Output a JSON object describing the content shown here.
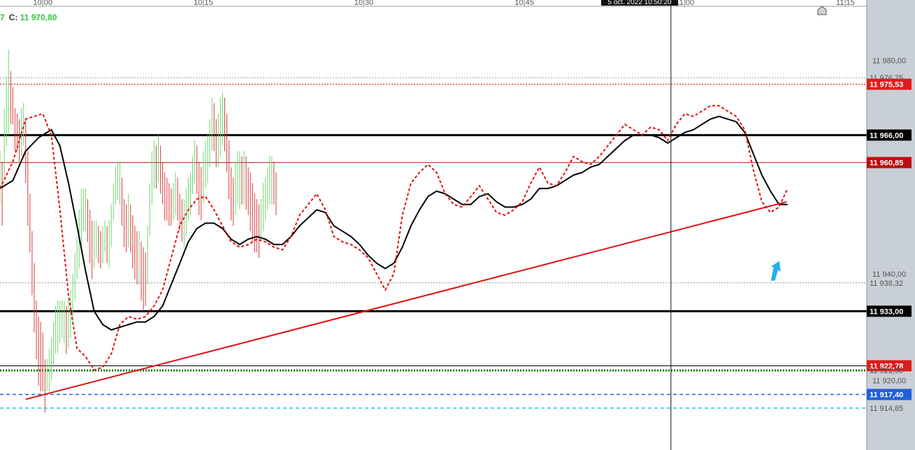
{
  "header": {
    "open_fragment": "7",
    "close_label": "C:",
    "close_value": "11 970,80",
    "cursor_date": "5 oct. 2022 10:50:20"
  },
  "colors": {
    "up_bar": "#6fd66f",
    "down_bar": "#d33a3a",
    "fast_ma": "#e01010",
    "slow_ma": "#000000",
    "trendline": "#e01010",
    "blue_dashed": "#1f5fd8",
    "cyan_dashed": "#21c0e6",
    "green_dotted": "#0a7a0a",
    "arrow": "#22b0ee"
  },
  "chart_data": {
    "type": "line",
    "title": "",
    "x_ticks": [
      {
        "t": 0,
        "label": "10:00"
      },
      {
        "t": 15,
        "label": "10:15"
      },
      {
        "t": 30,
        "label": "10:30"
      },
      {
        "t": 45,
        "label": "10:45"
      },
      {
        "t": 60,
        "label": "11:00"
      },
      {
        "t": 75,
        "label": "11:15"
      }
    ],
    "y_ticks": [
      {
        "v": 11980.0,
        "label": "11 980,00"
      },
      {
        "v": 11940.0,
        "label": "11 940,00"
      },
      {
        "v": 11920.0,
        "label": "11 920,00"
      }
    ],
    "xlim": [
      -4,
      77
    ],
    "ylim": [
      11907,
      11990
    ],
    "levels": [
      {
        "name": "level-11976",
        "v": 11976.75,
        "label": "11 976,75",
        "style": "grey-dotted",
        "tag": false
      },
      {
        "name": "level-11975",
        "v": 11975.53,
        "label": "11 975,53",
        "style": "red-dotted",
        "tag": "red"
      },
      {
        "name": "level-11966",
        "v": 11966.0,
        "label": "11 966,00",
        "style": "black-thick",
        "tag": "black"
      },
      {
        "name": "level-11960",
        "v": 11960.85,
        "label": "11 960,85",
        "style": "red-thin",
        "tag": "darkred"
      },
      {
        "name": "level-11938",
        "v": 11938.32,
        "label": "11 938,32",
        "style": "grey-dotted",
        "tag": false
      },
      {
        "name": "level-11933",
        "v": 11933.0,
        "label": "11 933,00",
        "style": "black-thick",
        "tag": "black"
      },
      {
        "name": "level-11922",
        "v": 11922.78,
        "label": "11 922,78",
        "style": "black-thin",
        "tag": "red"
      },
      {
        "name": "level-11921",
        "v": 11921.9,
        "label": "11 921,90",
        "style": "green-dotted",
        "tag": false
      },
      {
        "name": "level-11917",
        "v": 11917.4,
        "label": "11 917,40",
        "style": "blue-dashed",
        "tag": "blue"
      },
      {
        "name": "level-11914",
        "v": 11914.85,
        "label": "11 914,85",
        "style": "cyan-dashed",
        "tag": false
      }
    ],
    "trendline": {
      "t1": -1.6,
      "v1": 11916.5,
      "t2": 69.5,
      "v2": 11953.5
    },
    "cursor_t": 58.7,
    "arrow": {
      "t": 68.3,
      "v": 11942.0
    },
    "bars_t_start": -4,
    "bars_step": 0.2,
    "bars": [
      [
        11963.0,
        11953.0
      ],
      [
        11961.0,
        11949.0
      ],
      [
        11971.0,
        11958.0
      ],
      [
        11977.0,
        11964.0
      ],
      [
        11982.0,
        11966.0
      ],
      [
        11978.0,
        11968.0
      ],
      [
        11975.0,
        11968.0
      ],
      [
        11971.0,
        11963.0
      ],
      [
        11970.0,
        11963.0
      ],
      [
        11969.0,
        11961.0
      ],
      [
        11971.0,
        11962.0
      ],
      [
        11972.0,
        11964.0
      ],
      [
        11969.0,
        11957.0
      ],
      [
        11963.0,
        11949.0
      ],
      [
        11955.0,
        11944.0
      ],
      [
        11948.0,
        11936.0
      ],
      [
        11942.0,
        11929.0
      ],
      [
        11935.0,
        11924.0
      ],
      [
        11932.0,
        11919.0
      ],
      [
        11931.0,
        11918.0
      ],
      [
        11929.0,
        11918.0
      ],
      [
        11924.0,
        11914.0
      ],
      [
        11924.0,
        11918.0
      ],
      [
        11926.0,
        11918.0
      ],
      [
        11928.0,
        11920.0
      ],
      [
        11931.0,
        11923.0
      ],
      [
        11934.0,
        11925.0
      ],
      [
        11935.0,
        11925.0
      ],
      [
        11935.0,
        11927.0
      ],
      [
        11935.0,
        11928.0
      ],
      [
        11935.0,
        11927.0
      ],
      [
        11934.0,
        11925.0
      ],
      [
        11935.0,
        11926.0
      ],
      [
        11937.0,
        11928.0
      ],
      [
        11940.0,
        11931.0
      ],
      [
        11944.0,
        11935.0
      ],
      [
        11947.0,
        11939.0
      ],
      [
        11952.0,
        11941.0
      ],
      [
        11956.0,
        11945.0
      ],
      [
        11956.0,
        11948.0
      ],
      [
        11956.0,
        11948.0
      ],
      [
        11954.0,
        11946.0
      ],
      [
        11952.0,
        11942.0
      ],
      [
        11950.0,
        11939.0
      ],
      [
        11950.0,
        11941.0
      ],
      [
        11950.0,
        11943.0
      ],
      [
        11949.0,
        11942.0
      ],
      [
        11948.0,
        11941.0
      ],
      [
        11949.0,
        11942.0
      ],
      [
        11950.0,
        11944.0
      ],
      [
        11949.0,
        11942.0
      ],
      [
        11950.0,
        11941.0
      ],
      [
        11953.0,
        11945.0
      ],
      [
        11957.0,
        11950.0
      ],
      [
        11960.0,
        11953.0
      ],
      [
        11961.0,
        11954.0
      ],
      [
        11961.0,
        11953.0
      ],
      [
        11958.0,
        11949.0
      ],
      [
        11954.0,
        11945.0
      ],
      [
        11953.0,
        11944.0
      ],
      [
        11955.0,
        11945.0
      ],
      [
        11953.0,
        11944.0
      ],
      [
        11951.0,
        11941.0
      ],
      [
        11949.0,
        11939.0
      ],
      [
        11948.0,
        11938.0
      ],
      [
        11948.0,
        11938.0
      ],
      [
        11946.0,
        11935.0
      ],
      [
        11945.0,
        11933.0
      ],
      [
        11944.0,
        11934.0
      ],
      [
        11949.0,
        11938.0
      ],
      [
        11957.0,
        11947.0
      ],
      [
        11963.0,
        11953.0
      ],
      [
        11965.0,
        11956.0
      ],
      [
        11964.0,
        11956.0
      ],
      [
        11966.0,
        11957.0
      ],
      [
        11964.0,
        11955.0
      ],
      [
        11961.0,
        11953.0
      ],
      [
        11959.0,
        11950.0
      ],
      [
        11958.0,
        11950.0
      ],
      [
        11957.0,
        11949.0
      ],
      [
        11956.0,
        11949.0
      ],
      [
        11957.0,
        11950.0
      ],
      [
        11959.0,
        11951.0
      ],
      [
        11958.0,
        11950.0
      ],
      [
        11955.0,
        11948.0
      ],
      [
        11954.0,
        11946.0
      ],
      [
        11954.0,
        11945.0
      ],
      [
        11956.0,
        11947.0
      ],
      [
        11958.0,
        11950.0
      ],
      [
        11959.0,
        11951.0
      ],
      [
        11962.0,
        11955.0
      ],
      [
        11965.0,
        11957.0
      ],
      [
        11964.0,
        11955.0
      ],
      [
        11961.0,
        11951.0
      ],
      [
        11960.0,
        11950.0
      ],
      [
        11963.0,
        11953.0
      ],
      [
        11965.0,
        11956.0
      ],
      [
        11966.0,
        11957.0
      ],
      [
        11969.0,
        11960.0
      ],
      [
        11973.0,
        11963.0
      ],
      [
        11972.0,
        11963.0
      ],
      [
        11969.0,
        11960.0
      ],
      [
        11970.0,
        11960.0
      ],
      [
        11973.0,
        11962.0
      ],
      [
        11974.0,
        11964.0
      ],
      [
        11973.0,
        11963.0
      ],
      [
        11970.0,
        11959.0
      ],
      [
        11965.0,
        11954.0
      ],
      [
        11960.0,
        11950.0
      ],
      [
        11958.0,
        11949.0
      ],
      [
        11961.0,
        11951.0
      ],
      [
        11963.0,
        11953.0
      ],
      [
        11963.0,
        11952.0
      ],
      [
        11962.0,
        11953.0
      ],
      [
        11963.0,
        11953.0
      ],
      [
        11962.0,
        11952.0
      ],
      [
        11960.0,
        11951.0
      ],
      [
        11959.0,
        11948.0
      ],
      [
        11957.0,
        11946.0
      ],
      [
        11955.0,
        11944.0
      ],
      [
        11954.0,
        11944.0
      ],
      [
        11953.0,
        11943.0
      ],
      [
        11954.0,
        11946.0
      ],
      [
        11957.0,
        11948.0
      ],
      [
        11958.0,
        11950.0
      ],
      [
        11960.0,
        11952.0
      ],
      [
        11962.0,
        11953.0
      ],
      [
        11962.0,
        11953.0
      ],
      [
        11961.0,
        11953.0
      ],
      [
        11959.0,
        11951.0
      ]
    ],
    "fast_ma": [
      {
        "t": -4.0,
        "v": 11956.0
      },
      {
        "t": -2.8,
        "v": 11961.0
      },
      {
        "t": -1.6,
        "v": 11969.0
      },
      {
        "t": -0.8,
        "v": 11969.5
      },
      {
        "t": 0.0,
        "v": 11970.0
      },
      {
        "t": 0.8,
        "v": 11966.0
      },
      {
        "t": 1.6,
        "v": 11952.0
      },
      {
        "t": 2.4,
        "v": 11936.0
      },
      {
        "t": 3.2,
        "v": 11926.0
      },
      {
        "t": 4.0,
        "v": 11924.5
      },
      {
        "t": 4.8,
        "v": 11922.0
      },
      {
        "t": 5.6,
        "v": 11922.5
      },
      {
        "t": 6.4,
        "v": 11925.0
      },
      {
        "t": 7.2,
        "v": 11930.5
      },
      {
        "t": 8.0,
        "v": 11932.0
      },
      {
        "t": 8.8,
        "v": 11931.5
      },
      {
        "t": 9.6,
        "v": 11932.0
      },
      {
        "t": 10.4,
        "v": 11934.0
      },
      {
        "t": 11.2,
        "v": 11937.0
      },
      {
        "t": 12.0,
        "v": 11943.0
      },
      {
        "t": 12.8,
        "v": 11949.0
      },
      {
        "t": 13.6,
        "v": 11952.0
      },
      {
        "t": 14.4,
        "v": 11954.0
      },
      {
        "t": 15.2,
        "v": 11954.5
      },
      {
        "t": 16.0,
        "v": 11952.0
      },
      {
        "t": 16.8,
        "v": 11949.0
      },
      {
        "t": 17.6,
        "v": 11946.0
      },
      {
        "t": 18.4,
        "v": 11945.0
      },
      {
        "t": 19.2,
        "v": 11945.5
      },
      {
        "t": 20.0,
        "v": 11946.5
      },
      {
        "t": 20.8,
        "v": 11946.0
      },
      {
        "t": 21.6,
        "v": 11945.0
      },
      {
        "t": 22.4,
        "v": 11944.5
      },
      {
        "t": 23.2,
        "v": 11947.0
      },
      {
        "t": 24.0,
        "v": 11951.0
      },
      {
        "t": 24.8,
        "v": 11953.0
      },
      {
        "t": 25.6,
        "v": 11955.0
      },
      {
        "t": 26.4,
        "v": 11952.0
      },
      {
        "t": 27.2,
        "v": 11947.0
      },
      {
        "t": 28.0,
        "v": 11946.0
      },
      {
        "t": 28.8,
        "v": 11945.5
      },
      {
        "t": 29.6,
        "v": 11944.5
      },
      {
        "t": 30.4,
        "v": 11943.0
      },
      {
        "t": 31.2,
        "v": 11940.0
      },
      {
        "t": 32.0,
        "v": 11937.0
      },
      {
        "t": 32.8,
        "v": 11940.0
      },
      {
        "t": 33.6,
        "v": 11951.0
      },
      {
        "t": 34.4,
        "v": 11957.0
      },
      {
        "t": 35.2,
        "v": 11959.0
      },
      {
        "t": 36.0,
        "v": 11960.5
      },
      {
        "t": 36.8,
        "v": 11959.0
      },
      {
        "t": 37.6,
        "v": 11955.0
      },
      {
        "t": 38.4,
        "v": 11953.0
      },
      {
        "t": 39.2,
        "v": 11952.5
      },
      {
        "t": 40.0,
        "v": 11954.5
      },
      {
        "t": 40.8,
        "v": 11956.5
      },
      {
        "t": 41.6,
        "v": 11954.0
      },
      {
        "t": 42.4,
        "v": 11951.5
      },
      {
        "t": 43.2,
        "v": 11951.0
      },
      {
        "t": 44.0,
        "v": 11952.0
      },
      {
        "t": 44.8,
        "v": 11953.5
      },
      {
        "t": 45.6,
        "v": 11957.0
      },
      {
        "t": 46.4,
        "v": 11960.0
      },
      {
        "t": 47.2,
        "v": 11957.0
      },
      {
        "t": 48.0,
        "v": 11956.5
      },
      {
        "t": 48.8,
        "v": 11959.0
      },
      {
        "t": 49.6,
        "v": 11962.0
      },
      {
        "t": 50.4,
        "v": 11961.0
      },
      {
        "t": 51.2,
        "v": 11960.5
      },
      {
        "t": 52.0,
        "v": 11962.0
      },
      {
        "t": 52.8,
        "v": 11964.0
      },
      {
        "t": 53.6,
        "v": 11966.0
      },
      {
        "t": 54.4,
        "v": 11968.0
      },
      {
        "t": 55.2,
        "v": 11967.0
      },
      {
        "t": 56.0,
        "v": 11966.0
      },
      {
        "t": 56.8,
        "v": 11967.5
      },
      {
        "t": 57.6,
        "v": 11967.0
      },
      {
        "t": 58.4,
        "v": 11965.0
      },
      {
        "t": 59.2,
        "v": 11968.0
      },
      {
        "t": 60.0,
        "v": 11970.0
      },
      {
        "t": 60.8,
        "v": 11969.5
      },
      {
        "t": 61.6,
        "v": 11970.5
      },
      {
        "t": 62.4,
        "v": 11971.5
      },
      {
        "t": 63.2,
        "v": 11971.5
      },
      {
        "t": 64.0,
        "v": 11970.5
      },
      {
        "t": 64.8,
        "v": 11969.5
      },
      {
        "t": 65.6,
        "v": 11967.0
      },
      {
        "t": 66.4,
        "v": 11959.5
      },
      {
        "t": 67.2,
        "v": 11953.5
      },
      {
        "t": 68.0,
        "v": 11951.5
      },
      {
        "t": 68.8,
        "v": 11952.5
      },
      {
        "t": 69.6,
        "v": 11956.0
      }
    ],
    "slow_ma": [
      {
        "t": -4.0,
        "v": 11956.0
      },
      {
        "t": -2.8,
        "v": 11957.5
      },
      {
        "t": -1.6,
        "v": 11963.0
      },
      {
        "t": -0.4,
        "v": 11965.5
      },
      {
        "t": 0.8,
        "v": 11967.0
      },
      {
        "t": 1.6,
        "v": 11964.0
      },
      {
        "t": 2.4,
        "v": 11957.0
      },
      {
        "t": 3.2,
        "v": 11949.0
      },
      {
        "t": 4.0,
        "v": 11940.5
      },
      {
        "t": 4.8,
        "v": 11933.0
      },
      {
        "t": 5.6,
        "v": 11930.5
      },
      {
        "t": 6.4,
        "v": 11929.5
      },
      {
        "t": 7.2,
        "v": 11930.0
      },
      {
        "t": 8.0,
        "v": 11930.5
      },
      {
        "t": 8.8,
        "v": 11931.0
      },
      {
        "t": 9.6,
        "v": 11931.0
      },
      {
        "t": 10.4,
        "v": 11932.0
      },
      {
        "t": 11.2,
        "v": 11934.0
      },
      {
        "t": 12.0,
        "v": 11938.0
      },
      {
        "t": 12.8,
        "v": 11942.0
      },
      {
        "t": 13.6,
        "v": 11946.0
      },
      {
        "t": 14.4,
        "v": 11948.5
      },
      {
        "t": 15.2,
        "v": 11949.5
      },
      {
        "t": 16.0,
        "v": 11949.5
      },
      {
        "t": 16.8,
        "v": 11948.5
      },
      {
        "t": 17.6,
        "v": 11946.5
      },
      {
        "t": 18.4,
        "v": 11945.5
      },
      {
        "t": 19.2,
        "v": 11946.5
      },
      {
        "t": 20.0,
        "v": 11947.0
      },
      {
        "t": 20.8,
        "v": 11946.5
      },
      {
        "t": 21.6,
        "v": 11945.5
      },
      {
        "t": 22.4,
        "v": 11945.5
      },
      {
        "t": 23.2,
        "v": 11947.0
      },
      {
        "t": 24.0,
        "v": 11949.0
      },
      {
        "t": 24.8,
        "v": 11950.5
      },
      {
        "t": 25.6,
        "v": 11952.0
      },
      {
        "t": 26.4,
        "v": 11951.5
      },
      {
        "t": 27.2,
        "v": 11949.0
      },
      {
        "t": 28.0,
        "v": 11948.0
      },
      {
        "t": 28.8,
        "v": 11947.0
      },
      {
        "t": 29.6,
        "v": 11945.5
      },
      {
        "t": 30.4,
        "v": 11943.5
      },
      {
        "t": 31.2,
        "v": 11942.0
      },
      {
        "t": 32.0,
        "v": 11941.0
      },
      {
        "t": 32.8,
        "v": 11942.0
      },
      {
        "t": 33.6,
        "v": 11945.0
      },
      {
        "t": 34.4,
        "v": 11949.0
      },
      {
        "t": 35.2,
        "v": 11952.0
      },
      {
        "t": 36.0,
        "v": 11954.5
      },
      {
        "t": 36.8,
        "v": 11955.5
      },
      {
        "t": 37.6,
        "v": 11955.0
      },
      {
        "t": 38.4,
        "v": 11954.0
      },
      {
        "t": 39.2,
        "v": 11953.0
      },
      {
        "t": 40.0,
        "v": 11953.0
      },
      {
        "t": 40.8,
        "v": 11954.5
      },
      {
        "t": 41.6,
        "v": 11955.0
      },
      {
        "t": 42.4,
        "v": 11953.5
      },
      {
        "t": 43.2,
        "v": 11952.5
      },
      {
        "t": 44.0,
        "v": 11952.5
      },
      {
        "t": 44.8,
        "v": 11953.0
      },
      {
        "t": 45.6,
        "v": 11954.0
      },
      {
        "t": 46.4,
        "v": 11956.0
      },
      {
        "t": 47.2,
        "v": 11956.0
      },
      {
        "t": 48.0,
        "v": 11956.5
      },
      {
        "t": 48.8,
        "v": 11957.5
      },
      {
        "t": 49.6,
        "v": 11958.5
      },
      {
        "t": 50.4,
        "v": 11959.0
      },
      {
        "t": 51.2,
        "v": 11960.0
      },
      {
        "t": 52.0,
        "v": 11960.5
      },
      {
        "t": 52.8,
        "v": 11962.0
      },
      {
        "t": 53.6,
        "v": 11963.5
      },
      {
        "t": 54.4,
        "v": 11965.0
      },
      {
        "t": 55.2,
        "v": 11966.0
      },
      {
        "t": 56.0,
        "v": 11966.0
      },
      {
        "t": 56.8,
        "v": 11966.0
      },
      {
        "t": 57.6,
        "v": 11965.5
      },
      {
        "t": 58.4,
        "v": 11964.5
      },
      {
        "t": 59.2,
        "v": 11965.5
      },
      {
        "t": 60.0,
        "v": 11966.5
      },
      {
        "t": 60.8,
        "v": 11967.0
      },
      {
        "t": 61.6,
        "v": 11968.0
      },
      {
        "t": 62.4,
        "v": 11969.0
      },
      {
        "t": 63.2,
        "v": 11969.5
      },
      {
        "t": 64.0,
        "v": 11969.0
      },
      {
        "t": 64.8,
        "v": 11968.5
      },
      {
        "t": 65.6,
        "v": 11966.5
      },
      {
        "t": 66.4,
        "v": 11962.5
      },
      {
        "t": 67.2,
        "v": 11958.5
      },
      {
        "t": 68.0,
        "v": 11955.5
      },
      {
        "t": 68.8,
        "v": 11953.0
      },
      {
        "t": 69.6,
        "v": 11953.0
      }
    ]
  }
}
